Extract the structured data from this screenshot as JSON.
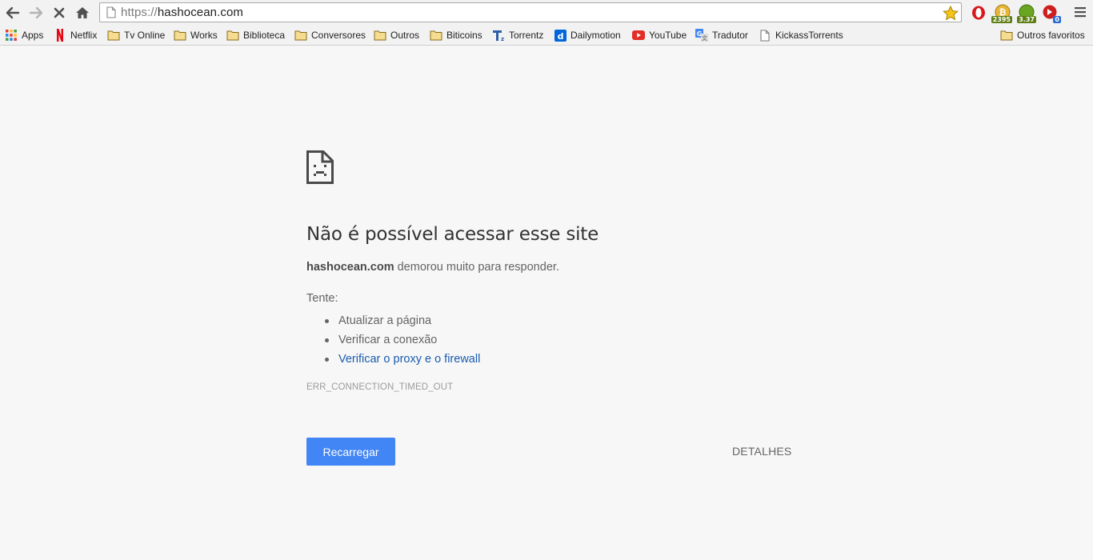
{
  "browser": {
    "url_scheme": "https://",
    "url_host": "hashocean.com",
    "nav": {
      "back_icon": "back-arrow-icon",
      "forward_icon": "forward-arrow-icon",
      "stop_icon": "stop-icon",
      "home_icon": "home-icon"
    },
    "extensions": [
      {
        "icon": "opera-adblock-icon",
        "badge": ""
      },
      {
        "icon": "bitcoin-ticker-icon",
        "badge": "2395"
      },
      {
        "icon": "green-ticker-icon",
        "badge": "3.37"
      },
      {
        "icon": "lastpass-icon",
        "badge": "0"
      }
    ],
    "colors": {
      "toolbar": "#f2f2f2",
      "accent": "#4285f4",
      "link": "#1a5cb0"
    }
  },
  "bookmarks": [
    {
      "label": "Apps",
      "icon": "apps-grid-icon"
    },
    {
      "label": "Netflix",
      "icon": "netflix-icon"
    },
    {
      "label": "Tv Online",
      "icon": "folder-icon"
    },
    {
      "label": "Works",
      "icon": "folder-icon"
    },
    {
      "label": "Biblioteca",
      "icon": "folder-icon"
    },
    {
      "label": "Conversores",
      "icon": "folder-icon"
    },
    {
      "label": "Outros",
      "icon": "folder-icon"
    },
    {
      "label": "Biticoins",
      "icon": "folder-icon"
    },
    {
      "label": "Torrentz",
      "icon": "torrentz-icon"
    },
    {
      "label": "Dailymotion",
      "icon": "dailymotion-icon"
    },
    {
      "label": "YouTube",
      "icon": "youtube-icon"
    },
    {
      "label": "Tradutor",
      "icon": "google-translate-icon"
    },
    {
      "label": "KickassTorrents",
      "icon": "page-icon"
    }
  ],
  "other_bookmarks": {
    "label": "Outros favoritos",
    "icon": "folder-icon"
  },
  "error": {
    "title": "Não é possível acessar esse site",
    "host": "hashocean.com",
    "description_suffix": " demorou muito para responder.",
    "try_label": "Tente:",
    "suggestions": [
      "Atualizar a página",
      "Verificar a conexão",
      "Verificar o proxy e o firewall"
    ],
    "code": "ERR_CONNECTION_TIMED_OUT",
    "reload_label": "Recarregar",
    "details_label": "DETALHES"
  }
}
